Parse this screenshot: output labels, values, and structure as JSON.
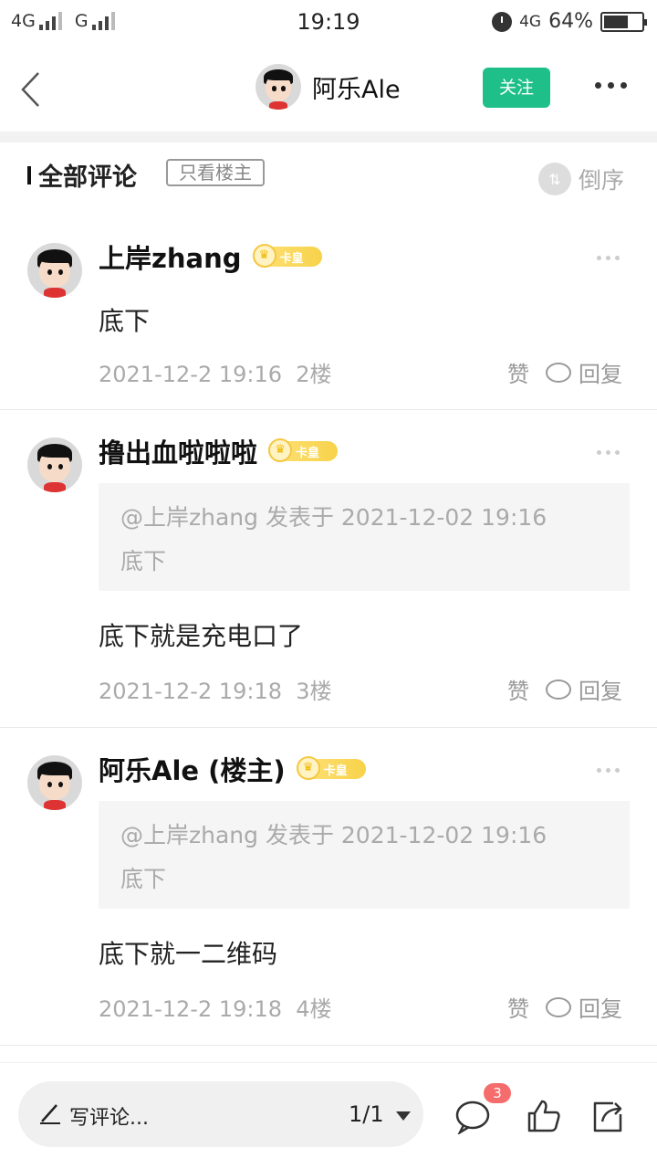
{
  "status_bar": {
    "network_left_1": "4G",
    "network_left_2": "G",
    "time": "19:19",
    "network_right": "4G",
    "battery": "64%"
  },
  "nav": {
    "back_icon": "chevron-left-icon",
    "title": "阿乐Ale",
    "follow_label": "关注",
    "more_icon": "more-dots-icon"
  },
  "section": {
    "title": "全部评论",
    "only_op_label": "只看楼主",
    "sort_label": "倒序"
  },
  "badge_text": "卡皇",
  "comments": [
    {
      "author": "上岸zhang",
      "text": "底下",
      "date": "2021-12-2 19:16",
      "floor": "2楼",
      "like_label": "赞",
      "reply_label": "回复"
    },
    {
      "author": "撸出血啦啦啦",
      "quote_line1": "@上岸zhang 发表于 2021-12-02 19:16",
      "quote_line2": "底下",
      "text": "底下就是充电口了",
      "date": "2021-12-2 19:18",
      "floor": "3楼",
      "like_label": "赞",
      "reply_label": "回复"
    },
    {
      "author": "阿乐Ale (楼主)",
      "quote_line1": "@上岸zhang 发表于 2021-12-02 19:16",
      "quote_line2": "底下",
      "text": "底下就一二维码",
      "date": "2021-12-2 19:18",
      "floor": "4楼",
      "like_label": "赞",
      "reply_label": "回复"
    }
  ],
  "bottom_bar": {
    "write_placeholder": "写评论...",
    "page": "1/1",
    "comment_count": "3",
    "icons": [
      "pencil-icon",
      "comment-icon",
      "like-icon",
      "share-icon"
    ]
  },
  "colors": {
    "accent": "#1fbf8a",
    "badge": "#f7d24a",
    "count_badge": "#f56c6c"
  }
}
